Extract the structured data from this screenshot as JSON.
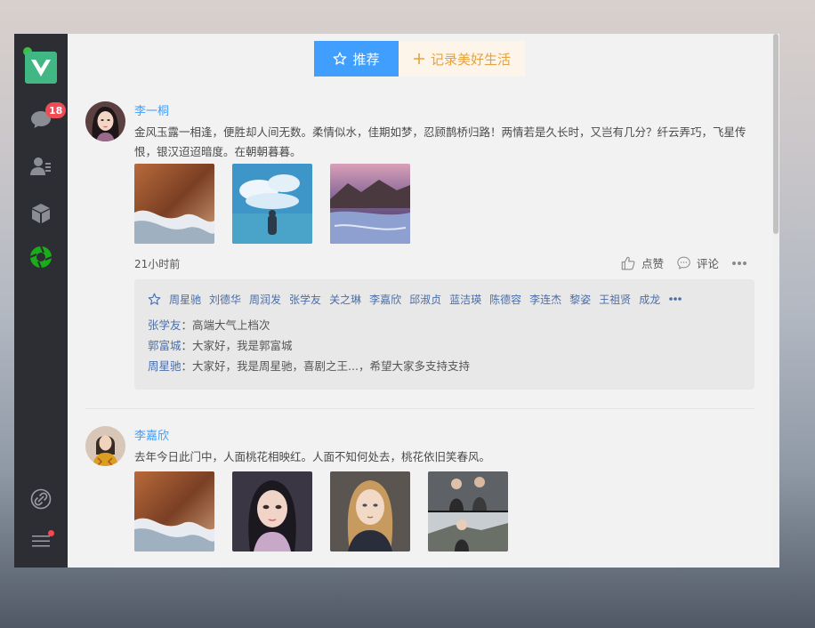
{
  "sidebar": {
    "chat_badge": "18",
    "icons": [
      "vue-logo-icon",
      "chat-icon",
      "contacts-icon",
      "cube-icon",
      "aperture-icon",
      "link-icon",
      "menu-icon"
    ]
  },
  "topbar": {
    "recommend_label": "推荐",
    "record_label": "记录美好生活"
  },
  "posts": [
    {
      "author": "李一桐",
      "content": "金风玉露一相逢，便胜却人间无数。柔情似水，佳期如梦，忍顾鹊桥归路！两情若是久长时，又岂有几分？纤云弄巧，飞星传恨，银汉迢迢暗度。在朝朝暮暮。",
      "time": "21小时前",
      "like_label": "点赞",
      "comment_label": "评论",
      "likers": [
        "周星驰",
        "刘德华",
        "周润发",
        "张学友",
        "关之琳",
        "李嘉欣",
        "邱淑贞",
        "蓝洁瑛",
        "陈德容",
        "李连杰",
        "黎姿",
        "王祖贤",
        "成龙"
      ],
      "comments": [
        {
          "name": "张学友",
          "sep": "：",
          "text": "高端大气上档次"
        },
        {
          "name": "郭富城",
          "sep": "：",
          "text": "大家好，我是郭富城"
        },
        {
          "name": "周星驰",
          "sep": "：",
          "text": "大家好，我是周星驰，喜剧之王...，希望大家多支持支持"
        }
      ]
    },
    {
      "author": "李嘉欣",
      "content": "去年今日此门中，人面桃花相映红。人面不知何处去，桃花依旧笑春风。"
    }
  ],
  "colors": {
    "accent": "#409eff",
    "record": "#e6a23c",
    "sidebar": "#2c2e33",
    "badge": "#f04b55",
    "logo": "#41b883"
  }
}
